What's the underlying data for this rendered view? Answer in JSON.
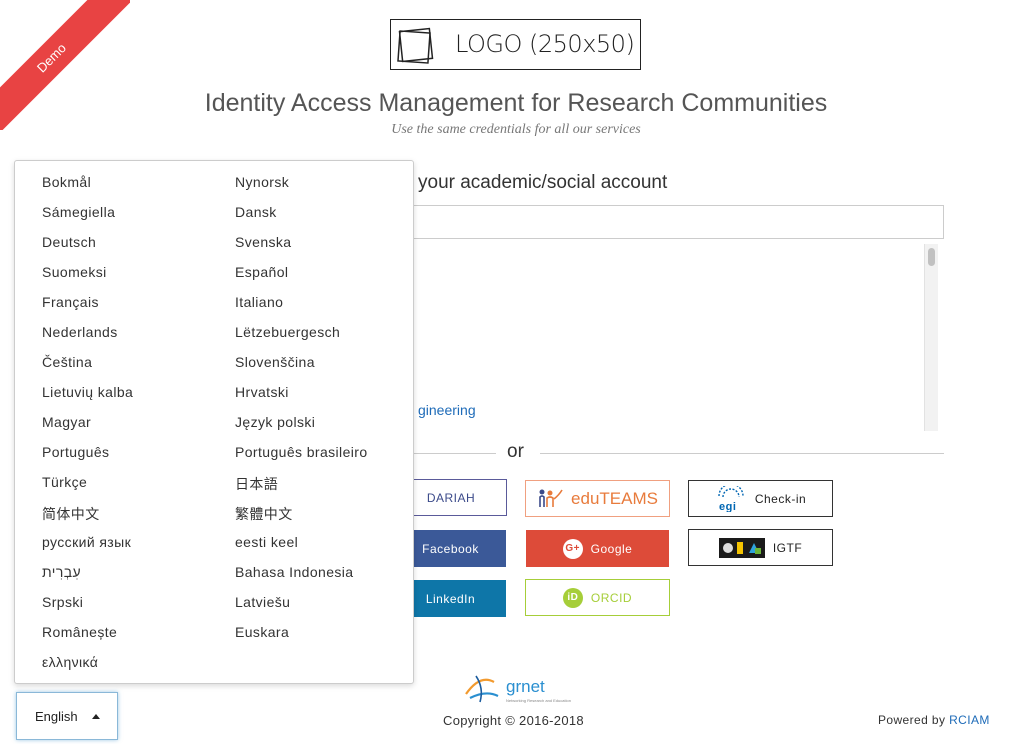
{
  "ribbon": {
    "label": "Demo"
  },
  "logo": {
    "text": "LOGO (250x50)"
  },
  "header": {
    "title": "Identity Access Management for Research Communities",
    "subtitle": "Use the same credentials for all our services"
  },
  "login": {
    "heading": "your academic/social account",
    "search_value": "",
    "idp_partial_link": "gineering",
    "or_label": "or"
  },
  "providers": {
    "dariah": "DARIAH",
    "eduteams": "eduTEAMS",
    "checkin": "Check-in",
    "facebook": "Facebook",
    "google": "Google",
    "igtf": "IGTF",
    "linkedin": "LinkedIn",
    "orcid": "ORCID",
    "google_icon": "G+",
    "orcid_icon": "iD",
    "egi_icon": "egi"
  },
  "languages": {
    "left": [
      "Bokmål",
      "Sámegiella",
      "Deutsch",
      "Suomeksi",
      "Français",
      "Nederlands",
      "Čeština",
      "Lietuvių kalba",
      "Magyar",
      "Português",
      "Türkçe",
      "简体中文",
      "русский язык",
      "עִבְרִית",
      "Srpski",
      "Românește",
      "ελληνικά"
    ],
    "right": [
      "Nynorsk",
      "Dansk",
      "Svenska",
      "Español",
      "Italiano",
      "Lëtzebuergesch",
      "Slovenščina",
      "Hrvatski",
      "Język polski",
      "Português brasileiro",
      "日本語",
      "繁體中文",
      "eesti keel",
      "Bahasa Indonesia",
      "Latviešu",
      "Euskara"
    ]
  },
  "language_selector": {
    "current": "English"
  },
  "footer": {
    "grnet": "grnet",
    "grnet_tagline": "Networking Research and Education",
    "copyright": "Copyright © 2016-2018",
    "powered_by": "Powered by",
    "powered_link": "RCIAM"
  }
}
